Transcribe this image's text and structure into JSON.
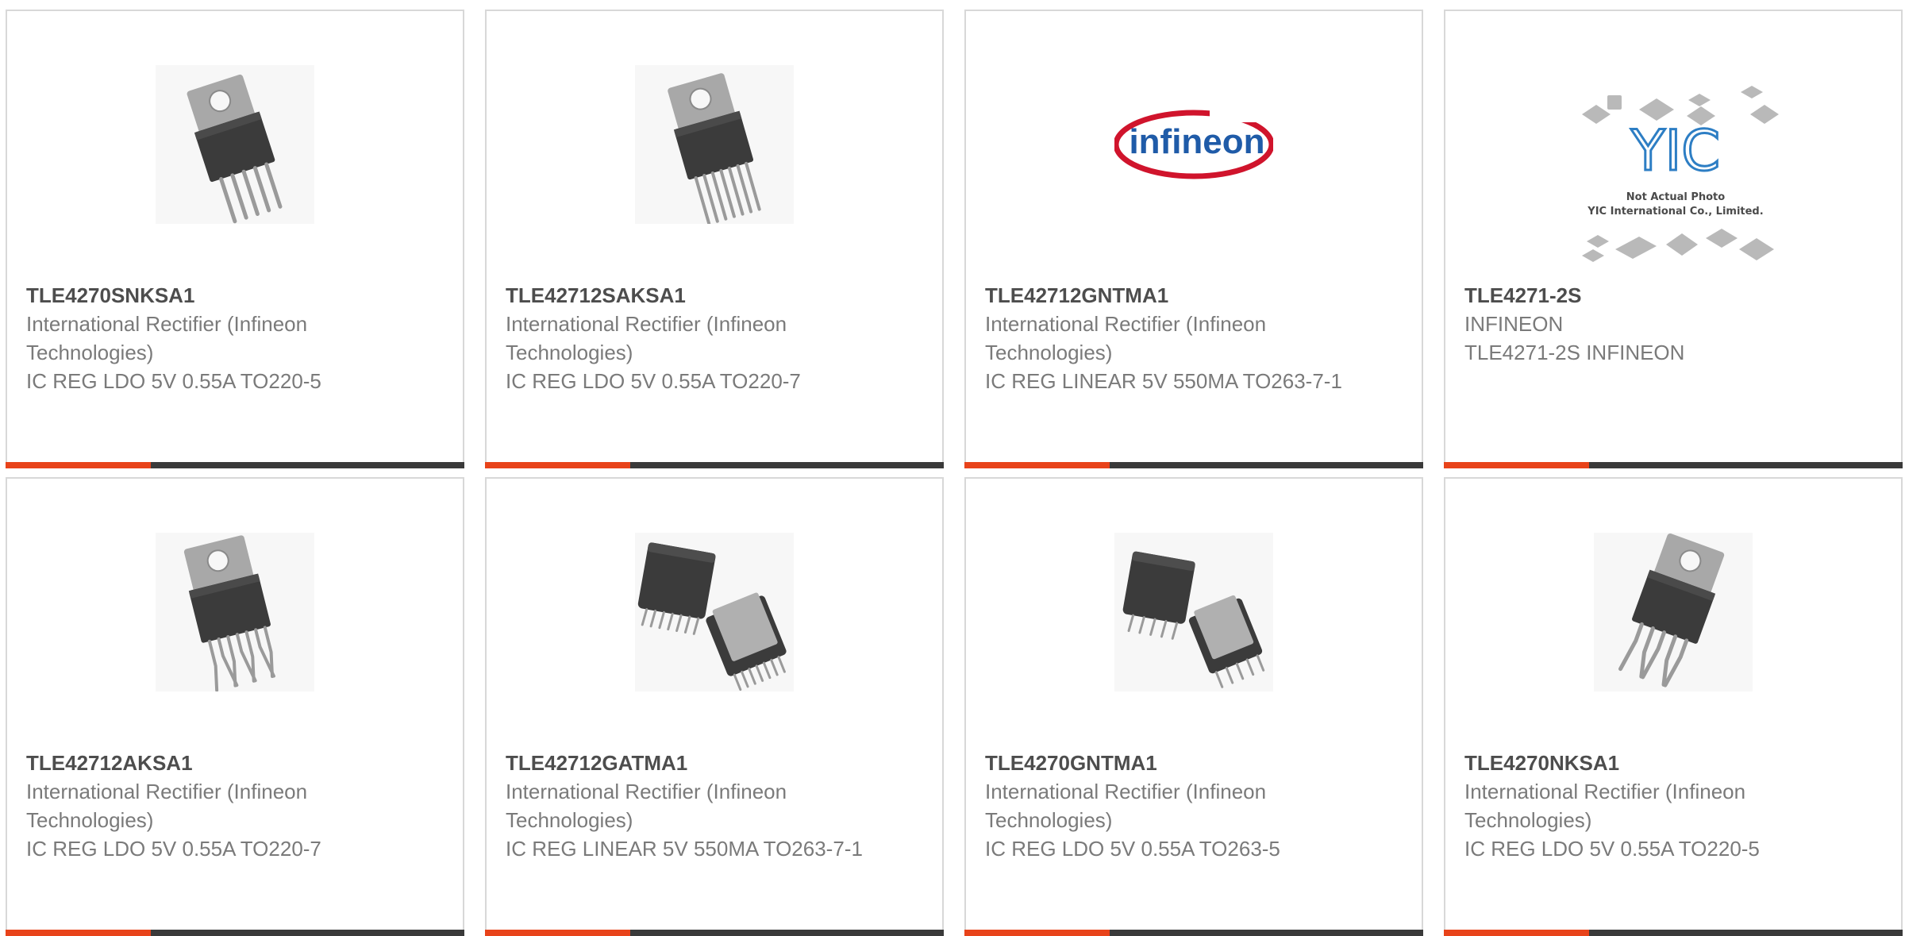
{
  "accent_color": "#e8431a",
  "bar_color": "#3a3a3a",
  "products": [
    {
      "part": "TLE4270SNKSA1",
      "manufacturer": "International Rectifier (Infineon Technologies)",
      "description": "IC REG LDO 5V 0.55A TO220-5",
      "image": "to220-5-package-icon"
    },
    {
      "part": "TLE42712SAKSA1",
      "manufacturer": "International Rectifier (Infineon Technologies)",
      "description": "IC REG LDO 5V 0.55A TO220-7",
      "image": "to220-7-package-icon"
    },
    {
      "part": "TLE42712GNTMA1",
      "manufacturer": "International Rectifier (Infineon Technologies)",
      "description": "IC REG LINEAR 5V 550MA TO263-7-1",
      "image": "infineon-logo",
      "logo_text": "infineon"
    },
    {
      "part": "TLE4271-2S",
      "manufacturer": "INFINEON",
      "description": "TLE4271-2S INFINEON",
      "image": "yic-placeholder",
      "logo_text": "YIC",
      "caption_line1": "Not Actual Photo",
      "caption_line2": "YIC International Co., Limited."
    },
    {
      "part": "TLE42712AKSA1",
      "manufacturer": "International Rectifier (Infineon Technologies)",
      "description": "IC REG LDO 5V 0.55A TO220-7",
      "image": "to220-7-bent-package-icon"
    },
    {
      "part": "TLE42712GATMA1",
      "manufacturer": "International Rectifier (Infineon Technologies)",
      "description": "IC REG LINEAR 5V 550MA TO263-7-1",
      "image": "to263-7-package-icon"
    },
    {
      "part": "TLE4270GNTMA1",
      "manufacturer": "International Rectifier (Infineon Technologies)",
      "description": "IC REG LDO 5V 0.55A TO263-5",
      "image": "to263-5-package-icon"
    },
    {
      "part": "TLE4270NKSA1",
      "manufacturer": "International Rectifier (Infineon Technologies)",
      "description": "IC REG LDO 5V 0.55A TO220-5",
      "image": "to220-5-bent-package-icon"
    }
  ]
}
